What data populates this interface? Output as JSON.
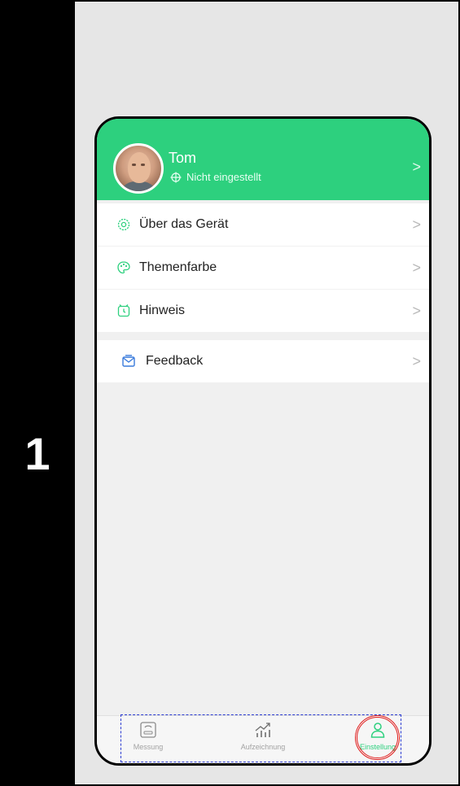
{
  "step": {
    "number": "1"
  },
  "profile": {
    "name": "Tom",
    "status": "Nicht eingestellt",
    "chevron": ">"
  },
  "menu": {
    "group1": [
      {
        "label": "Über das Gerät",
        "icon": "gear-icon"
      },
      {
        "label": "Themenfarbe",
        "icon": "palette-icon"
      },
      {
        "label": "Hinweis",
        "icon": "alarm-clock-icon"
      }
    ],
    "group2": [
      {
        "label": "Feedback",
        "icon": "feedback-icon"
      }
    ],
    "chevron": ">"
  },
  "tabbar": {
    "tabs": [
      {
        "label": "Messung",
        "icon": "scale-icon"
      },
      {
        "label": "Aufzeichnung",
        "icon": "chart-icon"
      },
      {
        "label": "Einstellung",
        "icon": "user-icon"
      }
    ],
    "active_index": 2
  },
  "colors": {
    "accent": "#2dd07e",
    "highlight_dashed": "#2b3bd1",
    "highlight_circle": "#e01a1a"
  }
}
